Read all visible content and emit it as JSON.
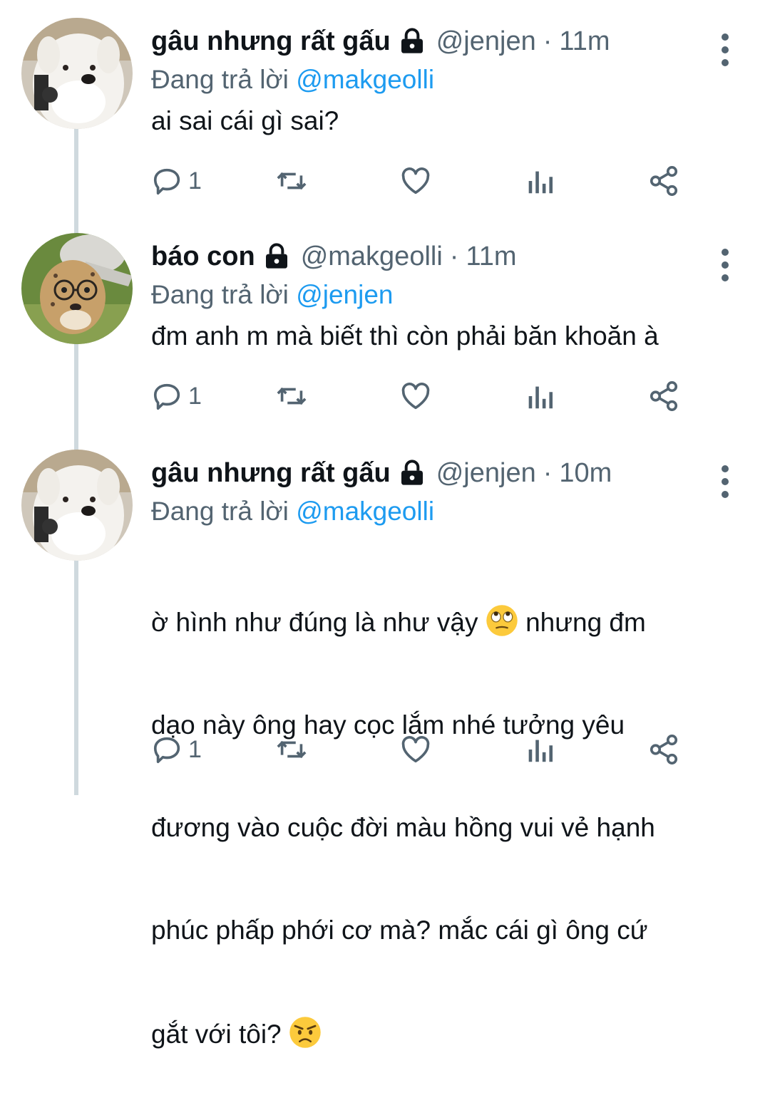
{
  "colors": {
    "text": "#0f1419",
    "muted": "#536471",
    "link": "#1d9bf0",
    "thread_line": "#cfd9de"
  },
  "tweets": [
    {
      "display_name": "gâu nhưng rất gấu",
      "handle": "@jenjen",
      "separator": "·",
      "time": "11m",
      "reply_prefix": "Đang trả lời",
      "reply_to": "@makgeolli",
      "text": "ai sai cái gì sai?",
      "reply_count": "1",
      "avatar_icon": "samoyed-dog-avatar"
    },
    {
      "display_name": "báo con",
      "handle": "@makgeolli",
      "separator": "·",
      "time": "11m",
      "reply_prefix": "Đang trả lời",
      "reply_to": "@jenjen",
      "text": "đm anh m mà biết thì còn phải băn khoăn à",
      "reply_count": "1",
      "avatar_icon": "cheetah-cub-avatar"
    },
    {
      "display_name": "gâu nhưng rất gấu",
      "handle": "@jenjen",
      "separator": "·",
      "time": "10m",
      "reply_prefix": "Đang trả lời",
      "reply_to": "@makgeolli",
      "text_line1a": "ờ hình như đúng là như vậy",
      "text_line1b": "nhưng đm",
      "text_line2": "dạo này ông hay cọc lắm nhé tưởng yêu",
      "text_line3": "đương vào cuộc đời màu hồng vui vẻ hạnh",
      "text_line4": "phúc phấp phới cơ mà? mắc cái gì ông cứ",
      "text_line5": "gắt với tôi?",
      "emoji1": "eye-roll-emoji",
      "emoji2": "angry-face-emoji",
      "reply_count": "1",
      "avatar_icon": "samoyed-dog-avatar"
    }
  ]
}
